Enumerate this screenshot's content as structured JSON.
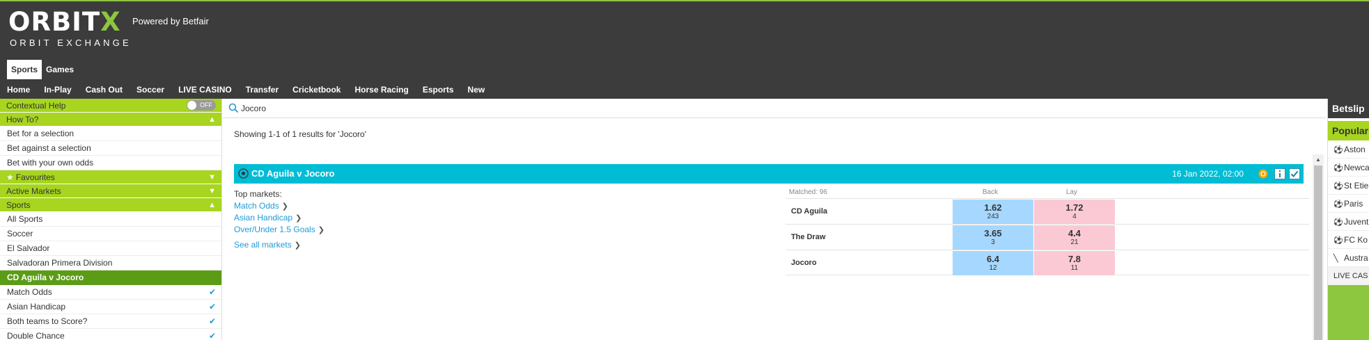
{
  "header": {
    "brand_main": "ORBIT",
    "brand_x": "X",
    "brand_sub": "ORBIT EXCHANGE",
    "powered_by": "Powered by Betfair",
    "top_tabs": [
      {
        "label": "Sports",
        "active": true
      },
      {
        "label": "Games",
        "active": false
      }
    ],
    "nav": [
      "Home",
      "In-Play",
      "Cash Out",
      "Soccer",
      "LIVE CASINO",
      "Transfer",
      "Cricketbook",
      "Horse Racing",
      "Esports",
      "New"
    ]
  },
  "sidebar": {
    "contextual_help": "Contextual Help",
    "toggle_label": "OFF",
    "how_to": "How To?",
    "how_to_items": [
      "Bet for a selection",
      "Bet against a selection",
      "Bet with your own odds"
    ],
    "favourites": "Favourites",
    "active_markets": "Active Markets",
    "sports": "Sports",
    "sports_items": [
      "All Sports",
      "Soccer",
      "El Salvador",
      "Salvadoran Primera Division"
    ],
    "event": "CD Aguila v Jocoro",
    "event_markets": [
      "Match Odds",
      "Asian Handicap",
      "Both teams to Score?",
      "Double Chance"
    ]
  },
  "search": {
    "value": "Jocoro",
    "results_text": "Showing 1-1 of 1 results for 'Jocoro'"
  },
  "event": {
    "title": "CD Aguila v Jocoro",
    "date": "16 Jan 2022, 02:00",
    "top_markets_label": "Top markets:",
    "markets": [
      "Match Odds",
      "Asian Handicap",
      "Over/Under 1.5 Goals"
    ],
    "see_all": "See all markets",
    "matched": "Matched: 96",
    "back_label": "Back",
    "lay_label": "Lay",
    "runners": [
      {
        "name": "CD Aguila",
        "back_price": "1.62",
        "back_size": "243",
        "lay_price": "1.72",
        "lay_size": "4"
      },
      {
        "name": "The Draw",
        "back_price": "3.65",
        "back_size": "3",
        "lay_price": "4.4",
        "lay_size": "21"
      },
      {
        "name": "Jocoro",
        "back_price": "6.4",
        "back_size": "12",
        "lay_price": "7.8",
        "lay_size": "11"
      }
    ]
  },
  "betslip": {
    "title": "Betslip",
    "popular": "Popular",
    "items": [
      {
        "label": "Aston",
        "icon": "soccer-ball-icon"
      },
      {
        "label": "Newca",
        "icon": "soccer-ball-icon"
      },
      {
        "label": "St Etie",
        "icon": "soccer-ball-icon"
      },
      {
        "label": "Paris",
        "icon": "soccer-ball-icon"
      },
      {
        "label": "Juvent",
        "icon": "soccer-ball-icon"
      },
      {
        "label": "FC Ko",
        "icon": "soccer-ball-icon"
      },
      {
        "label": "Austra",
        "icon": "cricket-bat-icon"
      }
    ],
    "casino": "LIVE CAS"
  },
  "colors": {
    "accent_green": "#a7d520",
    "header_bg": "#3c3c3c",
    "event_bar": "#00bcd4",
    "back": "#a6d8ff",
    "lay": "#fac9d4"
  }
}
